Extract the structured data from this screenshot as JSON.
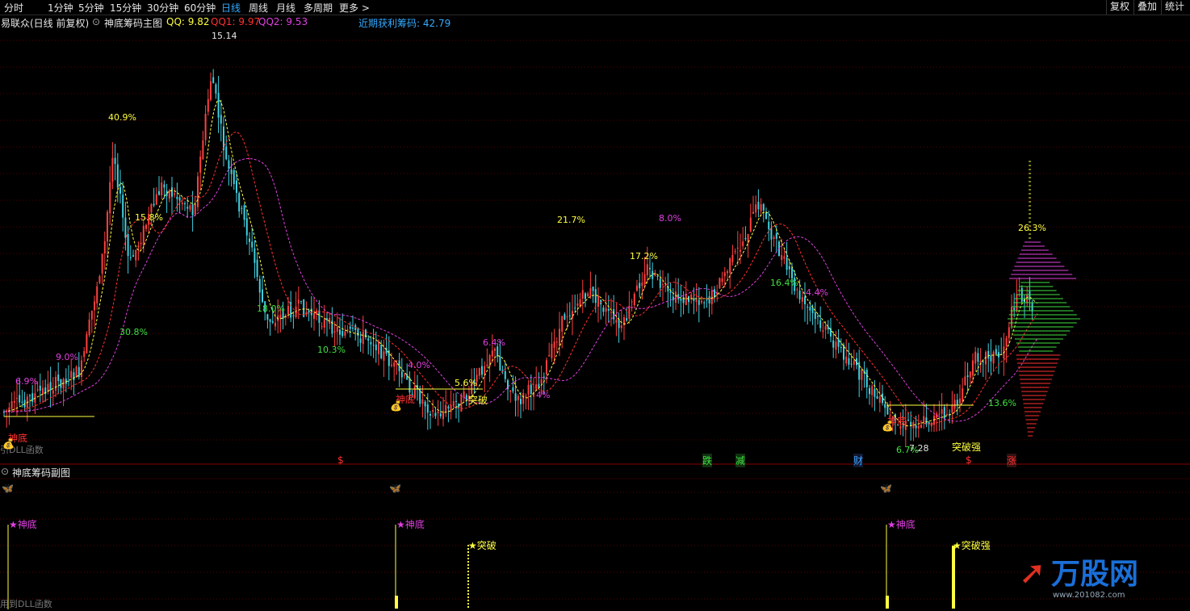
{
  "toolbar": {
    "periods": [
      "分时",
      "1分钟",
      "5分钟",
      "15分钟",
      "30分钟",
      "60分钟",
      "日线",
      "周线",
      "月线",
      "多周期",
      "更多 >"
    ],
    "active": "日线",
    "right_buttons": [
      "复权",
      "叠加",
      "统计"
    ]
  },
  "main_header": {
    "stock": "易联众(日线 前复权)",
    "indicator": "神底筹码主图",
    "qq": "QQ: 9.82",
    "qq1": "QQ1: 9.97",
    "qq2": "QQ2: 9.53",
    "profit_chip": "近期获利筹码: 42.79"
  },
  "sub_header": {
    "indicator": "神底筹码副图"
  },
  "main_annotations": {
    "high_price": "15.14",
    "low_price": "7.28",
    "dll_text_main": "引DLL函数",
    "dll_text_sub": "用到DLL函数",
    "pct_labels": [
      {
        "t": "6.9%",
        "c": "#e040e0"
      },
      {
        "t": "9.0%",
        "c": "#e040e0"
      },
      {
        "t": "40.9%",
        "c": "#ffff40"
      },
      {
        "t": "15.8%",
        "c": "#ffff40"
      },
      {
        "t": "30.8%",
        "c": "#40e040"
      },
      {
        "t": "18.0%",
        "c": "#40e040"
      },
      {
        "t": "10.3%",
        "c": "#40e040"
      },
      {
        "t": "4.0%",
        "c": "#e040e0"
      },
      {
        "t": "5.6%",
        "c": "#ffff40"
      },
      {
        "t": "6.4%",
        "c": "#e040e0"
      },
      {
        "t": "4%",
        "c": "#e040e0"
      },
      {
        "t": "21.7%",
        "c": "#ffff40"
      },
      {
        "t": "17.2%",
        "c": "#ffff40"
      },
      {
        "t": "8.0%",
        "c": "#e040e0"
      },
      {
        "t": "16.4%",
        "c": "#40e040"
      },
      {
        "t": "4.4%",
        "c": "#e040e0"
      },
      {
        "t": "6.7%",
        "c": "#40e040"
      },
      {
        "t": "26.3%",
        "c": "#ffff40"
      },
      {
        "t": "13.6%",
        "c": "#40e040"
      }
    ],
    "signals": [
      {
        "t": "神底",
        "c": "#ff3030"
      },
      {
        "t": "神底",
        "c": "#ff3030"
      },
      {
        "t": "神底",
        "c": "#ff3030"
      },
      {
        "t": "突破",
        "c": "#ffff40"
      },
      {
        "t": "突破强",
        "c": "#ffff40"
      }
    ],
    "bottom_tags": [
      {
        "t": "$",
        "c": "#ff3030"
      },
      {
        "t": "跌",
        "c": "#40e040"
      },
      {
        "t": "减",
        "c": "#40e040"
      },
      {
        "t": "财",
        "c": "#40a0ff"
      },
      {
        "t": "$",
        "c": "#ff3030"
      },
      {
        "t": "涨",
        "c": "#ff3030"
      }
    ]
  },
  "sub_annotations": {
    "labels": [
      {
        "t": "★神底",
        "c": "#e040e0"
      },
      {
        "t": "★神底",
        "c": "#e040e0"
      },
      {
        "t": "★神底",
        "c": "#e040e0"
      },
      {
        "t": "★突破",
        "c": "#ffff40"
      },
      {
        "t": "★突破强",
        "c": "#ffff40"
      }
    ]
  },
  "watermark": {
    "name": "万股网",
    "url": "www.201082.com"
  },
  "colors": {
    "up": "#ff4040",
    "down": "#40d0e0",
    "ma_yellow": "#ffff40",
    "ma_red": "#ff3030",
    "ma_magenta": "#e040e0",
    "grid": "#5a0000"
  }
}
